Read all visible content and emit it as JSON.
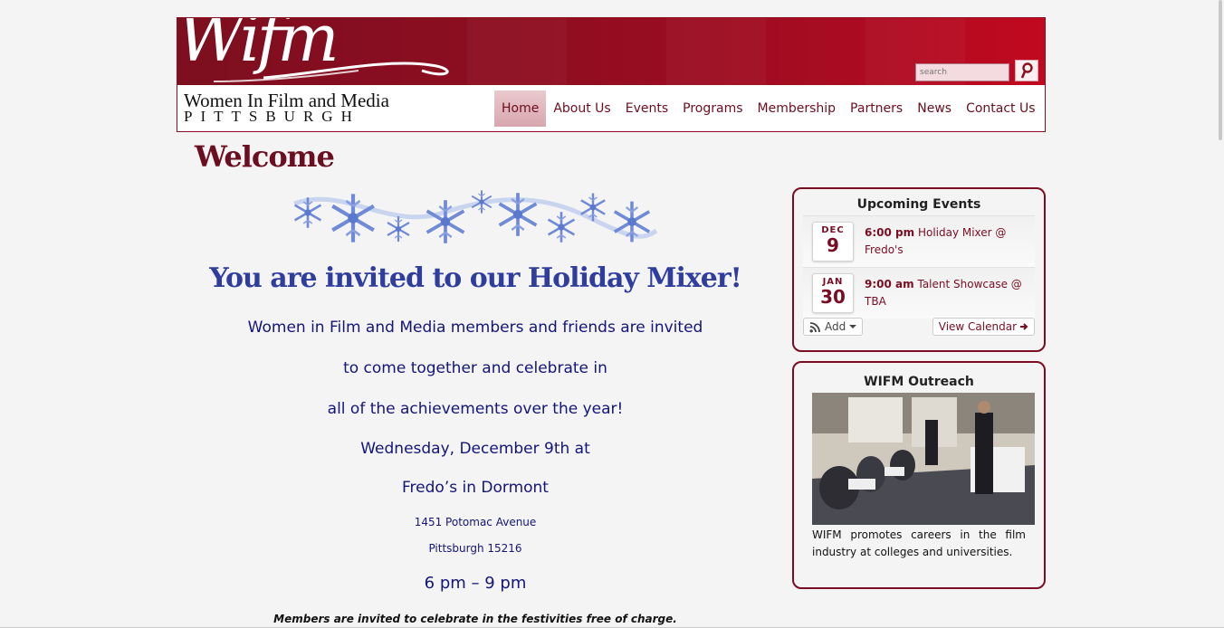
{
  "header": {
    "logo_text": "Wifm",
    "logo_line1": "Women In Film and Media",
    "logo_line2": "PITTSBURGH",
    "search_placeholder": "search",
    "search_icon": "search-icon"
  },
  "nav": {
    "items": [
      "Home",
      "About Us",
      "Events",
      "Programs",
      "Membership",
      "Partners",
      "News",
      "Contact Us"
    ],
    "active_index": 0
  },
  "main": {
    "page_title": "Welcome",
    "decoration": "snowflake-banner",
    "invite_heading": "You are invited to our Holiday Mixer!",
    "lines": [
      "Women in Film and Media members and friends are invited",
      "to come together and celebrate in",
      "all of the achievements over the year!",
      "Wednesday, December 9th at",
      "Fredo’s in Dormont"
    ],
    "address_line1": "1451 Potomac Avenue",
    "address_line2": "Pittsburgh 15216",
    "time_range": "6 pm – 9 pm",
    "note": "Members are invited to celebrate in the festivities free of charge."
  },
  "sidebar": {
    "events": {
      "title": "Upcoming Events",
      "items": [
        {
          "month": "DEC",
          "day": "9",
          "time": "6:00 pm",
          "name": "Holiday Mixer @ Fredo's"
        },
        {
          "month": "JAN",
          "day": "30",
          "time": "9:00 am",
          "name": "Talent Showcase @ TBA"
        }
      ],
      "add_label": "Add",
      "calendar_label": "View Calendar"
    },
    "outreach": {
      "title": "WIFM Outreach",
      "text": "WIFM promotes careers in the film industry at colleges and universities."
    }
  },
  "colors": {
    "brand": "#7a0d22",
    "banner_right": "#c1091f",
    "invite_blue": "#2f3d9e",
    "text_navy": "#13157a"
  }
}
